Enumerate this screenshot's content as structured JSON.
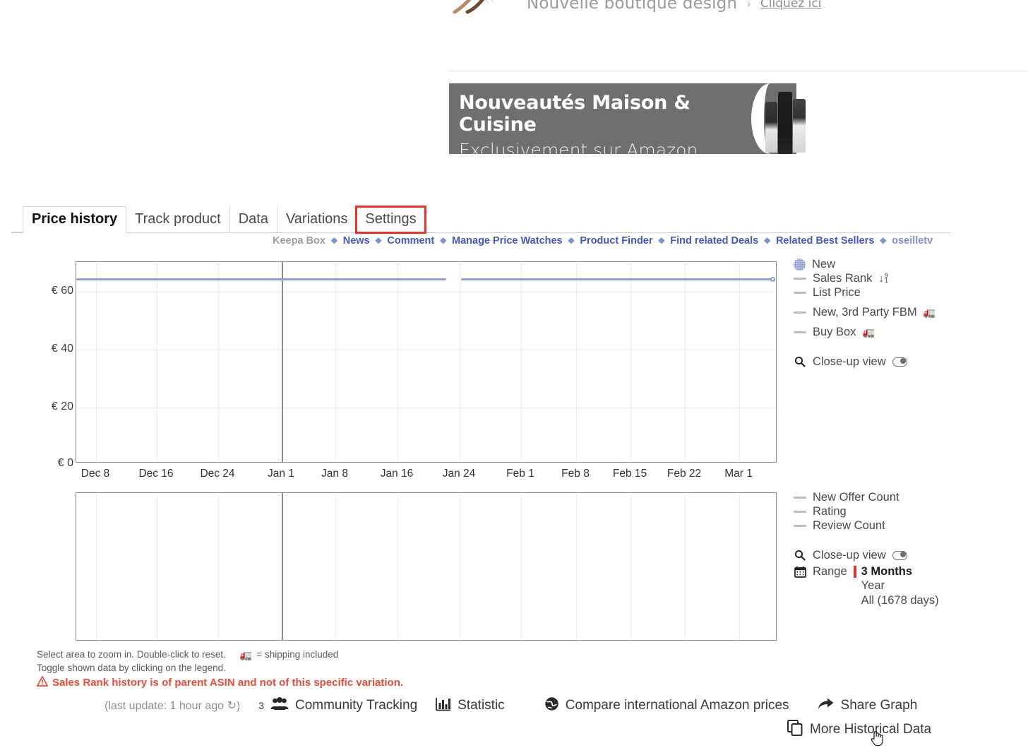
{
  "ads": {
    "top": {
      "text": "Nouvelle boutique design",
      "link_prefix": "›",
      "link": "Cliquez ici"
    },
    "banner": {
      "line1": "Nouveautés Maison & Cuisine",
      "line2": "Exclusivement sur Amazon"
    }
  },
  "tabs": [
    {
      "label": "Price history",
      "active": true,
      "highlight": false
    },
    {
      "label": "Track product",
      "active": false,
      "highlight": false
    },
    {
      "label": "Data",
      "active": false,
      "highlight": false
    },
    {
      "label": "Variations",
      "active": false,
      "highlight": false
    },
    {
      "label": "Settings",
      "active": false,
      "highlight": true
    }
  ],
  "keepa_links": [
    {
      "label": "Keepa Box",
      "kind": "plain"
    },
    {
      "label": "News",
      "kind": "link"
    },
    {
      "label": "Comment",
      "kind": "link"
    },
    {
      "label": "Manage Price Watches",
      "kind": "link"
    },
    {
      "label": "Product Finder",
      "kind": "link"
    },
    {
      "label": "Find related Deals",
      "kind": "link"
    },
    {
      "label": "Related Best Sellers",
      "kind": "link"
    },
    {
      "label": "oseilletv",
      "kind": "muted"
    }
  ],
  "legend_top": [
    {
      "label": "New",
      "marker": "circle-dotted",
      "truck": false
    },
    {
      "label": "Sales Rank",
      "marker": "dash",
      "rank": true
    },
    {
      "label": "List Price",
      "marker": "dash"
    },
    {
      "label": "New, 3rd Party FBM",
      "marker": "dash",
      "truck": true
    },
    {
      "label": "Buy Box",
      "marker": "dash",
      "truck": true
    }
  ],
  "legend_top_closeup": {
    "label": "Close-up view",
    "toggle": "off"
  },
  "legend_bottom": [
    {
      "label": "New Offer Count",
      "marker": "dash"
    },
    {
      "label": "Rating",
      "marker": "dash"
    },
    {
      "label": "Review Count",
      "marker": "dash"
    }
  ],
  "legend_bottom_closeup": {
    "label": "Close-up view",
    "toggle": "off"
  },
  "range": {
    "label": "Range",
    "selected": "3 Months",
    "options": [
      "3 Months",
      "Year",
      "All (1678 days)"
    ],
    "other_options": [
      "Year",
      "All (1678 days)"
    ],
    "accent": "#ef3124"
  },
  "notes": {
    "line1a": "Select area to zoom in. Double-click to reset.",
    "line1b": "= shipping included",
    "line2": "Toggle shown data by clicking on the legend.",
    "warning": "Sales Rank history is of parent ASIN and not of this specific variation."
  },
  "toolbar": {
    "last_update": "(last update: 1 hour ago ↻)",
    "community_count": "3",
    "community_label": "Community Tracking",
    "statistic_label": "Statistic",
    "compare_label": "Compare international Amazon prices",
    "share_label": "Share Graph",
    "more_data_label": "More Historical Data"
  },
  "chart_data": {
    "type": "line",
    "title": "Price history",
    "xlabel": "",
    "ylabel": "",
    "currency": "€",
    "ylim": [
      0,
      70
    ],
    "yticks": [
      0,
      20,
      40,
      60
    ],
    "ytick_labels": [
      "€ 0",
      "€ 20",
      "€ 40",
      "€ 60"
    ],
    "xtick_labels": [
      "Dec 8",
      "Dec 16",
      "Dec 24",
      "Jan 1",
      "Jan 8",
      "Jan 16",
      "Jan 24",
      "Feb 1",
      "Feb 8",
      "Feb 15",
      "Feb 22",
      "Mar 1"
    ],
    "grid": true,
    "legend_position": "right",
    "year_boundary_label": "Jan 1",
    "series": [
      {
        "name": "New",
        "color": "#8d9fd4",
        "values": [
          64.9,
          64.9,
          64.9,
          64.9,
          64.9,
          64.9,
          64.9,
          64.9,
          64.9,
          64.9,
          64.9,
          64.9
        ],
        "constant_value": 64.9,
        "gap_between": [
          "Jan 24",
          "Jan 28"
        ],
        "end_marker": true
      },
      {
        "name": "Sales Rank",
        "color": "#bdbdbd",
        "values": []
      },
      {
        "name": "List Price",
        "color": "#bdbdbd",
        "values": []
      },
      {
        "name": "New, 3rd Party FBM",
        "color": "#bdbdbd",
        "values": []
      },
      {
        "name": "Buy Box",
        "color": "#bdbdbd",
        "values": []
      }
    ],
    "secondary_panel": {
      "type": "line",
      "series": [
        {
          "name": "New Offer Count",
          "color": "#bdbdbd",
          "values": []
        },
        {
          "name": "Rating",
          "color": "#bdbdbd",
          "values": []
        },
        {
          "name": "Review Count",
          "color": "#bdbdbd",
          "values": []
        }
      ],
      "empty": true
    }
  }
}
